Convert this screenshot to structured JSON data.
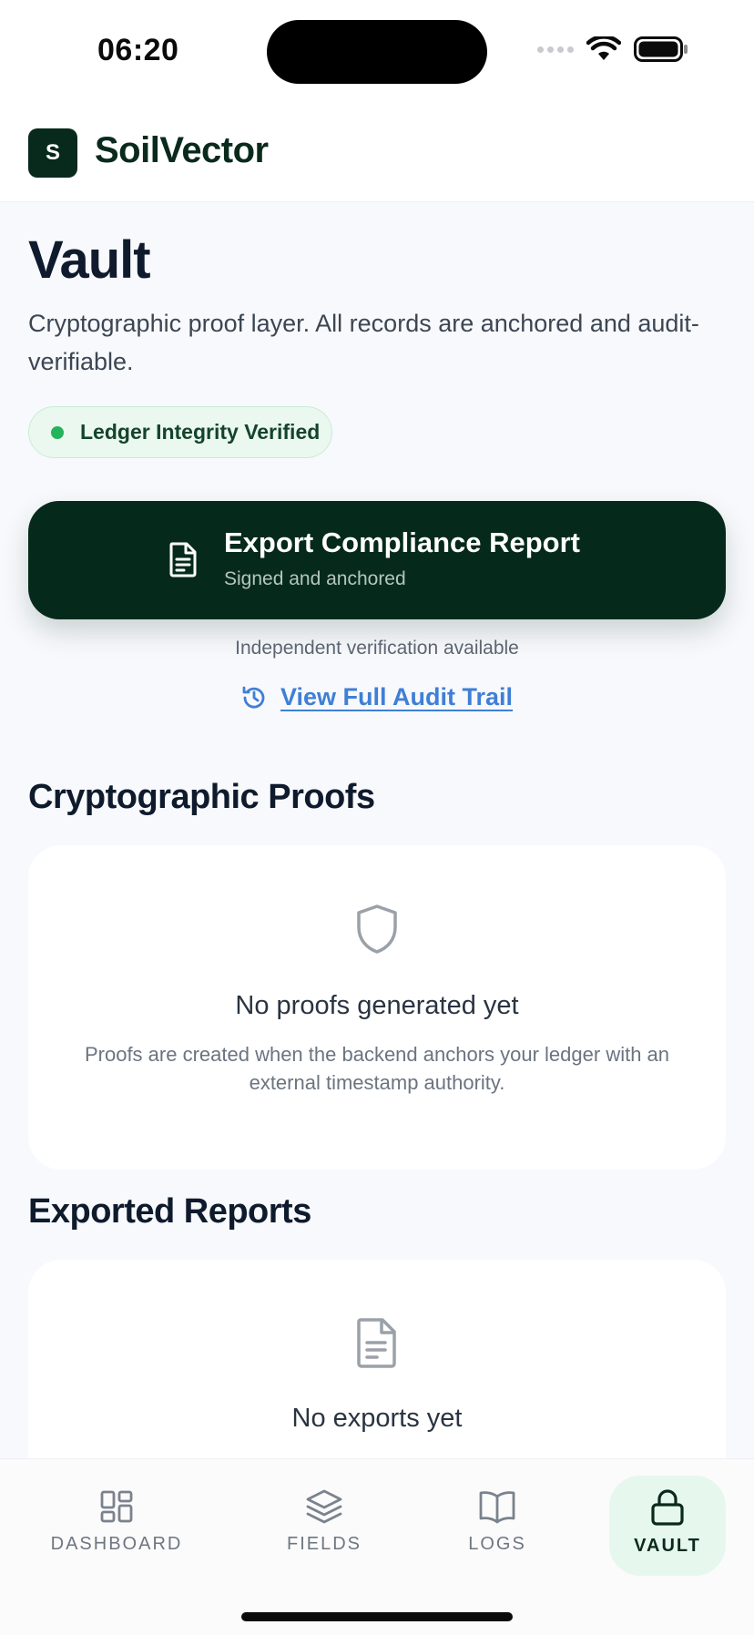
{
  "status_bar": {
    "time": "06:20"
  },
  "header": {
    "logo_letter": "S",
    "brand": "SoilVector"
  },
  "vault": {
    "title": "Vault",
    "subtitle": "Cryptographic proof layer. All records are anchored and audit-verifiable.",
    "badge": "Ledger Integrity Verified",
    "export_button": {
      "title": "Export Compliance Report",
      "subtitle": "Signed and anchored"
    },
    "verification_note": "Independent verification available",
    "audit_link": "View Full Audit Trail"
  },
  "proofs": {
    "section_title": "Cryptographic Proofs",
    "empty_title": "No proofs generated yet",
    "empty_desc": "Proofs are created when the backend anchors your ledger with an external timestamp authority."
  },
  "reports": {
    "section_title": "Exported Reports",
    "empty_title": "No exports yet"
  },
  "tabs": [
    {
      "label": "DASHBOARD",
      "icon": "grid-icon"
    },
    {
      "label": "FIELDS",
      "icon": "layers-icon"
    },
    {
      "label": "LOGS",
      "icon": "book-icon"
    },
    {
      "label": "VAULT",
      "icon": "lock-icon",
      "active": true
    }
  ],
  "colors": {
    "brand_dark": "#052a1c",
    "link_blue": "#3f7fd6",
    "success_green": "#22b45a",
    "active_tab_bg": "#e6f7ee"
  }
}
